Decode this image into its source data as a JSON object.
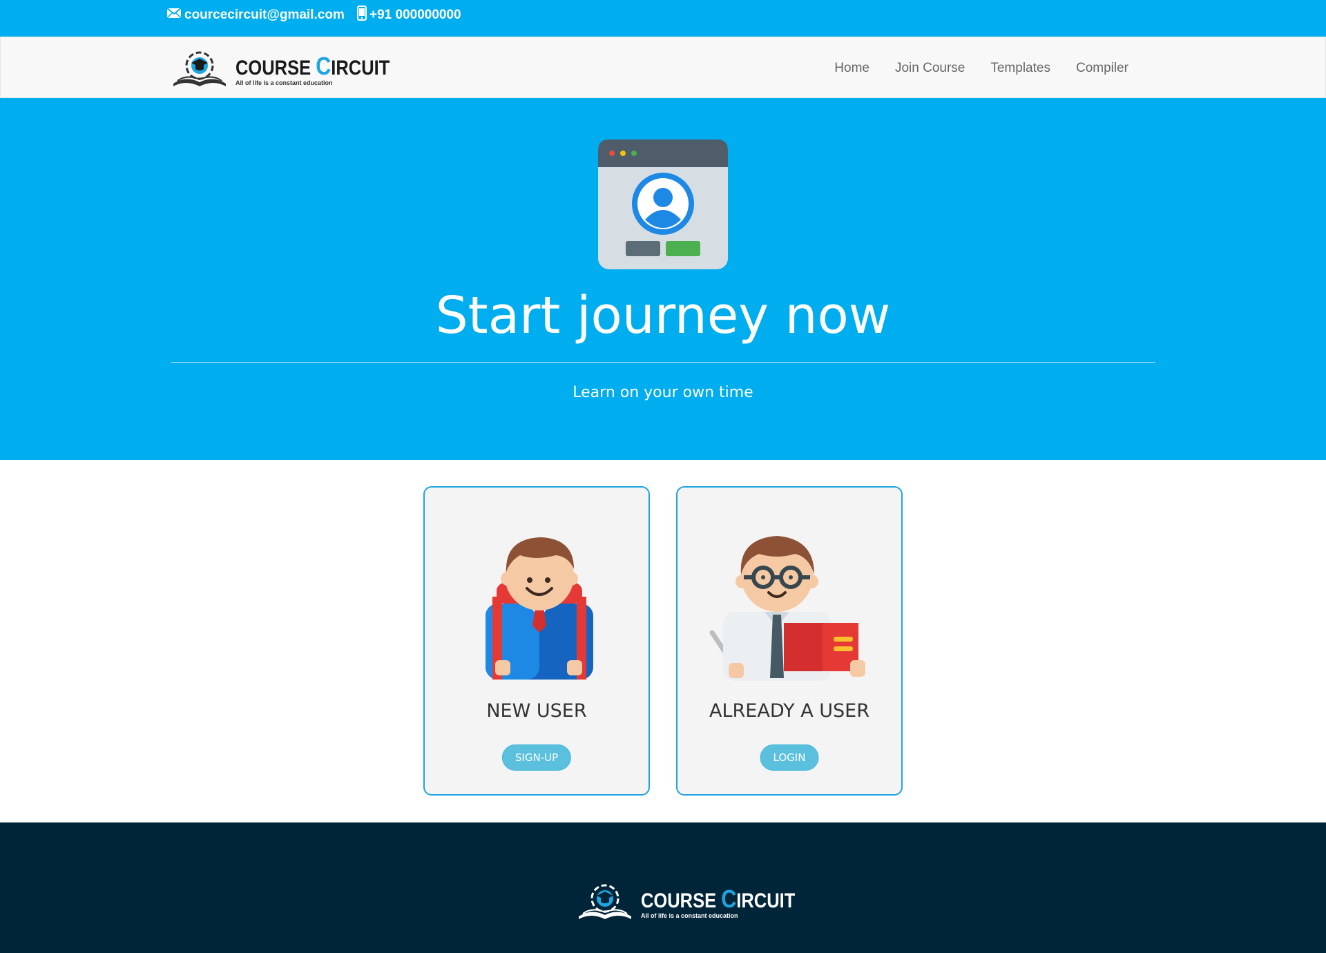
{
  "topbar": {
    "email": "courcecircuit@gmail.com",
    "phone": "+91 000000000",
    "email_icon": "envelope-icon",
    "phone_icon": "mobile-phone-icon"
  },
  "brand": {
    "title_first_initial": "C",
    "title_first_rest": "OURSE",
    "title_second_initial": "C",
    "title_second_rest": "IRCUIT",
    "tagline": "All of life is a constant education"
  },
  "nav": {
    "items": [
      "Home",
      "Join Course",
      "Templates",
      "Compiler"
    ]
  },
  "hero": {
    "icon": "user-profile-window-icon",
    "title": "Start journey now",
    "subtitle": "Learn on your own time"
  },
  "cards": [
    {
      "title": "NEW USER",
      "button": "SIGN-UP",
      "illustration": "student-illustration"
    },
    {
      "title": "ALREADY A USER",
      "button": "LOGIN",
      "illustration": "teacher-illustration"
    }
  ],
  "colors": {
    "primary_blue": "#00adef",
    "footer_navy": "#002438",
    "button_blue": "#5bc0de",
    "card_border": "#1ea4e0"
  }
}
